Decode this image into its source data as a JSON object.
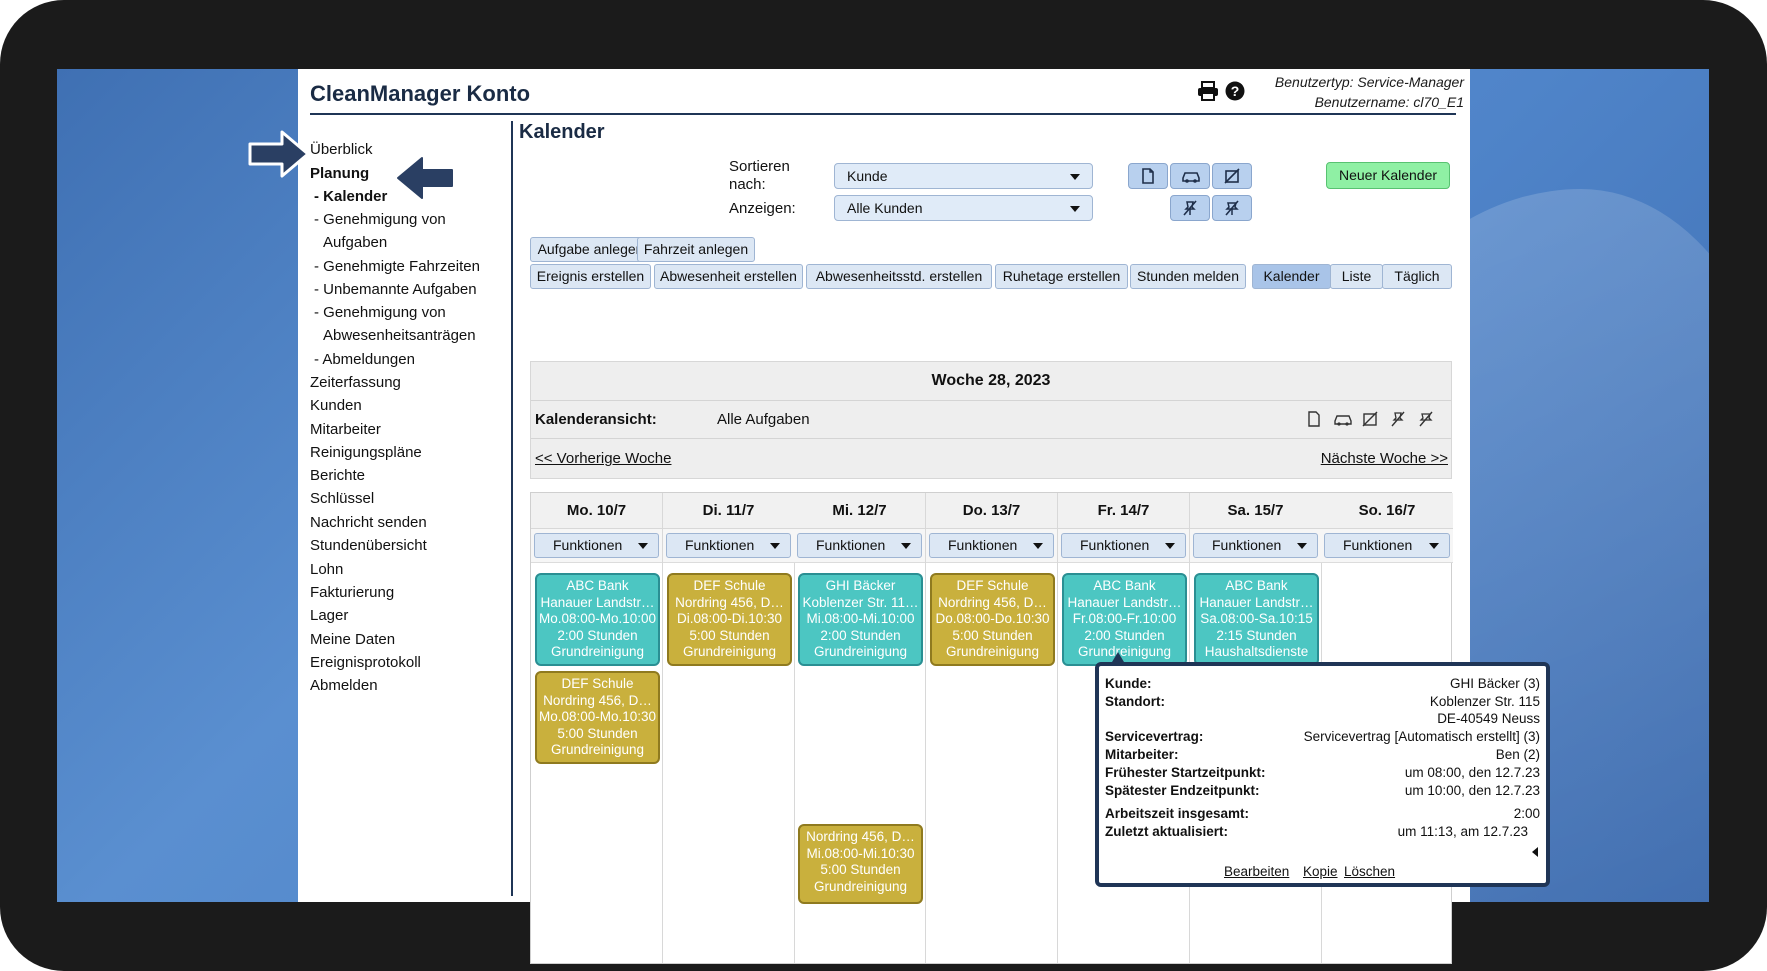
{
  "app": {
    "title": "CleanManager Konto",
    "user_type": "Benutzertyp: Service-Manager",
    "user_name": "Benutzername: cl70_E1"
  },
  "sidebar": {
    "items": [
      {
        "label": "Überblick",
        "bold": false
      },
      {
        "label": "Planung",
        "bold": true
      },
      {
        "label": "- Kalender",
        "bold": true
      },
      {
        "label": "- Genehmigung von",
        "bold": false
      },
      {
        "label": "Aufgaben",
        "bold": false
      },
      {
        "label": "- Genehmigte Fahrzeiten",
        "bold": false
      },
      {
        "label": "- Unbemannte Aufgaben",
        "bold": false
      },
      {
        "label": "- Genehmigung von",
        "bold": false
      },
      {
        "label": "Abwesenheitsanträgen",
        "bold": false
      },
      {
        "label": "- Abmeldungen",
        "bold": false
      },
      {
        "label": "Zeiterfassung",
        "bold": false
      },
      {
        "label": "Kunden",
        "bold": false
      },
      {
        "label": "Mitarbeiter",
        "bold": false
      },
      {
        "label": "Reinigungspläne",
        "bold": false
      },
      {
        "label": "Berichte",
        "bold": false
      },
      {
        "label": "Schlüssel",
        "bold": false
      },
      {
        "label": "Nachricht senden",
        "bold": false
      },
      {
        "label": "Stundenübersicht",
        "bold": false
      },
      {
        "label": "Lohn",
        "bold": false
      },
      {
        "label": "Fakturierung",
        "bold": false
      },
      {
        "label": "Lager",
        "bold": false
      },
      {
        "label": "Meine Daten",
        "bold": false
      },
      {
        "label": "Ereignisprotokoll",
        "bold": false
      },
      {
        "label": "Abmelden",
        "bold": false
      }
    ]
  },
  "main": {
    "title": "Kalender",
    "sort_label_1": "Sortieren",
    "sort_label_2": "nach:",
    "sort_value": "Kunde",
    "show_label": "Anzeigen:",
    "show_value": "Alle Kunden",
    "new_calendar": "Neuer Kalender",
    "toolbar_row1": [
      "Aufgabe anlegen",
      "Fahrzeit anlegen"
    ],
    "toolbar_row2": [
      "Ereignis erstellen",
      "Abwesenheit erstellen",
      "Abwesenheitsstd. erstellen",
      "Ruhetage erstellen",
      "Stunden melden"
    ],
    "view_tabs": [
      "Kalender",
      "Liste",
      "Täglich"
    ],
    "active_view": "Kalender"
  },
  "calendar": {
    "week_title": "Woche 28, 2023",
    "view_label": "Kalenderansicht:",
    "view_value": "Alle Aufgaben",
    "prev_week": "<< Vorherige Woche",
    "next_week": "Nächste Woche >>",
    "functions_label": "Funktionen",
    "days": [
      "Mo. 10/7",
      "Di. 11/7",
      "Mi. 12/7",
      "Do. 13/7",
      "Fr. 14/7",
      "Sa. 15/7",
      "So. 16/7"
    ],
    "events": [
      {
        "day": 0,
        "slot": 0,
        "color": "teal",
        "lines": [
          "ABC Bank",
          "Hanauer Landstr…",
          "Mo.08:00-Mo.10:00",
          "2:00 Stunden",
          "Grundreinigung"
        ]
      },
      {
        "day": 0,
        "slot": 1,
        "color": "gold",
        "lines": [
          "DEF Schule",
          "Nordring 456, D…",
          "Mo.08:00-Mo.10:30",
          "5:00 Stunden",
          "Grundreinigung"
        ]
      },
      {
        "day": 1,
        "slot": 0,
        "color": "gold",
        "lines": [
          "DEF Schule",
          "Nordring 456, D…",
          "Di.08:00-Di.10:30",
          "5:00 Stunden",
          "Grundreinigung"
        ]
      },
      {
        "day": 2,
        "slot": 0,
        "color": "teal",
        "lines": [
          "GHI Bäcker",
          "Koblenzer Str. 11…",
          "Mi.08:00-Mi.10:00",
          "2:00 Stunden",
          "Grundreinigung"
        ]
      },
      {
        "day": 2,
        "slot": 3,
        "color": "gold",
        "lines": [
          "Nordring 456, D…",
          "Mi.08:00-Mi.10:30",
          "5:00 Stunden",
          "Grundreinigung"
        ]
      },
      {
        "day": 3,
        "slot": 0,
        "color": "gold",
        "lines": [
          "DEF Schule",
          "Nordring 456, D…",
          "Do.08:00-Do.10:30",
          "5:00 Stunden",
          "Grundreinigung"
        ]
      },
      {
        "day": 4,
        "slot": 0,
        "color": "teal",
        "lines": [
          "ABC Bank",
          "Hanauer Landstr…",
          "Fr.08:00-Fr.10:00",
          "2:00 Stunden",
          "Grundreinigung"
        ]
      },
      {
        "day": 5,
        "slot": 0,
        "color": "teal",
        "lines": [
          "ABC Bank",
          "Hanauer Landstr…",
          "Sa.08:00-Sa.10:15",
          "2:15 Stunden",
          "Haushaltsdienste"
        ]
      }
    ]
  },
  "popup": {
    "rows": [
      {
        "label": "Kunde:",
        "value": "GHI Bäcker (3)"
      },
      {
        "label": "Standort:",
        "value": "Koblenzer Str. 115"
      },
      {
        "label": "",
        "value": "DE-40549 Neuss"
      },
      {
        "label": "Servicevertrag:",
        "value": "Servicevertrag [Automatisch erstellt] (3)"
      },
      {
        "label": "Mitarbeiter:",
        "value": "Ben (2)"
      },
      {
        "label": "Frühester Startzeitpunkt:",
        "value": "um 08:00, den 12.7.23"
      },
      {
        "label": "Spätester Endzeitpunkt:",
        "value": "um 10:00, den 12.7.23"
      },
      {
        "label": "Arbeitszeit insgesamt:",
        "value": "2:00"
      },
      {
        "label": "Zuletzt aktualisiert:",
        "value": "um 11:13, am 12.7.23"
      }
    ],
    "links": [
      "Bearbeiten",
      "Kopie",
      "Löschen"
    ]
  },
  "colors": {
    "event_teal": "#4cc6c2",
    "event_gold": "#c9b03d",
    "new_button": "#8ff0a4",
    "accent": "#1f3556"
  },
  "icons": [
    "print-icon",
    "help-icon",
    "document-icon",
    "car-icon",
    "no-calendar-icon",
    "no-pin-icon",
    "no-pin-alt-icon"
  ]
}
